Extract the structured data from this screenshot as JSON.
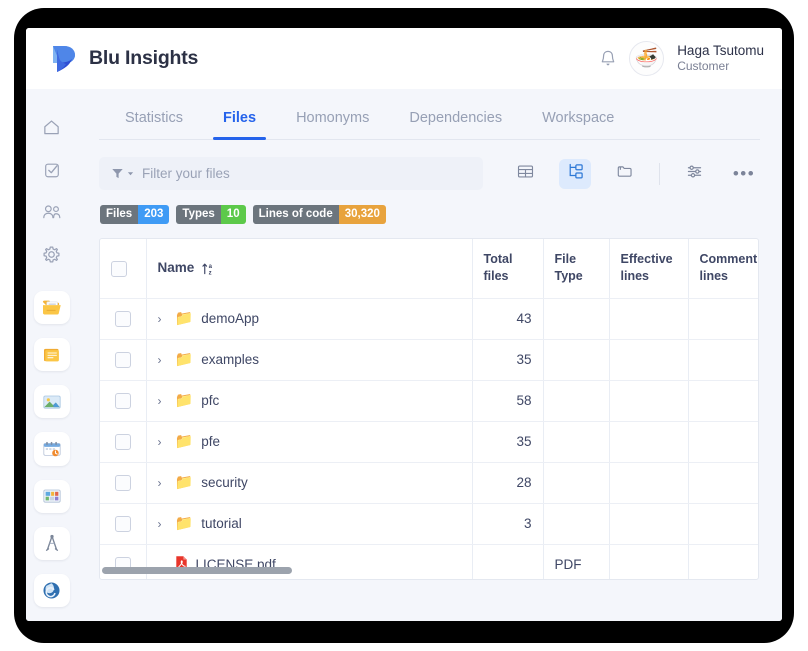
{
  "header": {
    "brand": "Blu Insights",
    "logo_icon": "blu-logo-icon",
    "bell_icon": "bell-icon",
    "avatar_icon": "ramen-bowl-avatar",
    "avatar_glyph": "🍜",
    "user_name": "Haga Tsutomu",
    "user_role": "Customer"
  },
  "sidebar": {
    "items": [
      {
        "name": "home",
        "icon": "home-icon",
        "glyph": "",
        "active": false,
        "card": false
      },
      {
        "name": "tasks",
        "icon": "checkbox-task-icon",
        "glyph": "",
        "active": false,
        "card": false
      },
      {
        "name": "users",
        "icon": "users-icon",
        "glyph": "",
        "active": false,
        "card": false
      },
      {
        "name": "settings",
        "icon": "gear-icon",
        "glyph": "",
        "active": false,
        "card": false
      },
      {
        "name": "files",
        "icon": "open-folder-document-icon",
        "glyph": "📂",
        "active": true,
        "card": true
      },
      {
        "name": "notes",
        "icon": "notes-pages-icon",
        "glyph": "🗂",
        "active": false,
        "card": true
      },
      {
        "name": "media",
        "icon": "image-picture-icon",
        "glyph": "🏙",
        "active": false,
        "card": true
      },
      {
        "name": "schedule",
        "icon": "calendar-icon",
        "glyph": "📅",
        "active": false,
        "card": true
      },
      {
        "name": "board",
        "icon": "board-chart-icon",
        "glyph": "🎛",
        "active": false,
        "card": true
      },
      {
        "name": "compass",
        "icon": "compass-divider-icon",
        "glyph": "",
        "active": false,
        "card": true
      },
      {
        "name": "globe",
        "icon": "globe-refresh-icon",
        "glyph": "",
        "active": false,
        "card": true
      }
    ]
  },
  "tabs": [
    {
      "label": "Statistics",
      "active": false
    },
    {
      "label": "Files",
      "active": true
    },
    {
      "label": "Homonyms",
      "active": false
    },
    {
      "label": "Dependencies",
      "active": false
    },
    {
      "label": "Workspace",
      "active": false
    }
  ],
  "toolbar": {
    "filter": {
      "icon": "filter-funnel-icon",
      "caret_icon": "caret-down-icon",
      "placeholder": "Filter your files",
      "value": ""
    },
    "buttons": [
      {
        "name": "table-view-button",
        "icon": "table-grid-icon",
        "active": false
      },
      {
        "name": "tree-view-button",
        "icon": "tree-view-icon",
        "active": true
      },
      {
        "name": "folder-view-button",
        "icon": "folder-icon",
        "active": false
      },
      {
        "name": "settings-sliders-button",
        "icon": "sliders-icon",
        "active": false
      },
      {
        "name": "more-options-button",
        "icon": "ellipsis-icon",
        "active": false,
        "label": "•••"
      }
    ]
  },
  "badges": [
    {
      "key": "Files",
      "value": "203",
      "color": "#3f9bf5"
    },
    {
      "key": "Types",
      "value": "10",
      "color": "#5cc94a"
    },
    {
      "key": "Lines of code",
      "value": "30,320",
      "color": "#e8a33d"
    }
  ],
  "table": {
    "select_all_checkbox": false,
    "sort_icon": "sort-alpha-ascending-icon",
    "columns": [
      {
        "label": "Name",
        "align": "left"
      },
      {
        "label": "Total files",
        "align": "right"
      },
      {
        "label": "File Type",
        "align": "left"
      },
      {
        "label": "Effective lines",
        "align": "left"
      },
      {
        "label": "Comment lines",
        "align": "left"
      }
    ],
    "rows": [
      {
        "name": "demoApp",
        "icon": "folder-icon",
        "glyph": "📁",
        "expandable": true,
        "total_files": "43",
        "file_type": "",
        "effective_lines": "",
        "comment_lines": ""
      },
      {
        "name": "examples",
        "icon": "folder-icon",
        "glyph": "📁",
        "expandable": true,
        "total_files": "35",
        "file_type": "",
        "effective_lines": "",
        "comment_lines": ""
      },
      {
        "name": "pfc",
        "icon": "folder-icon",
        "glyph": "📁",
        "expandable": true,
        "total_files": "58",
        "file_type": "",
        "effective_lines": "",
        "comment_lines": ""
      },
      {
        "name": "pfe",
        "icon": "folder-icon",
        "glyph": "📁",
        "expandable": true,
        "total_files": "35",
        "file_type": "",
        "effective_lines": "",
        "comment_lines": ""
      },
      {
        "name": "security",
        "icon": "folder-icon",
        "glyph": "📁",
        "expandable": true,
        "total_files": "28",
        "file_type": "",
        "effective_lines": "",
        "comment_lines": ""
      },
      {
        "name": "tutorial",
        "icon": "folder-icon",
        "glyph": "📁",
        "expandable": true,
        "total_files": "3",
        "file_type": "",
        "effective_lines": "",
        "comment_lines": ""
      },
      {
        "name": "LICENSE.pdf",
        "icon": "pdf-file-icon",
        "glyph": "",
        "expandable": false,
        "total_files": "",
        "file_type": "PDF",
        "effective_lines": "",
        "comment_lines": ""
      }
    ]
  },
  "colors": {
    "accent": "#2563eb",
    "page_bg": "#f4f6fb",
    "panel_bg": "#ffffff",
    "text": "#3f4765",
    "muted": "#97a0b5",
    "folder": "#f5b93d"
  }
}
